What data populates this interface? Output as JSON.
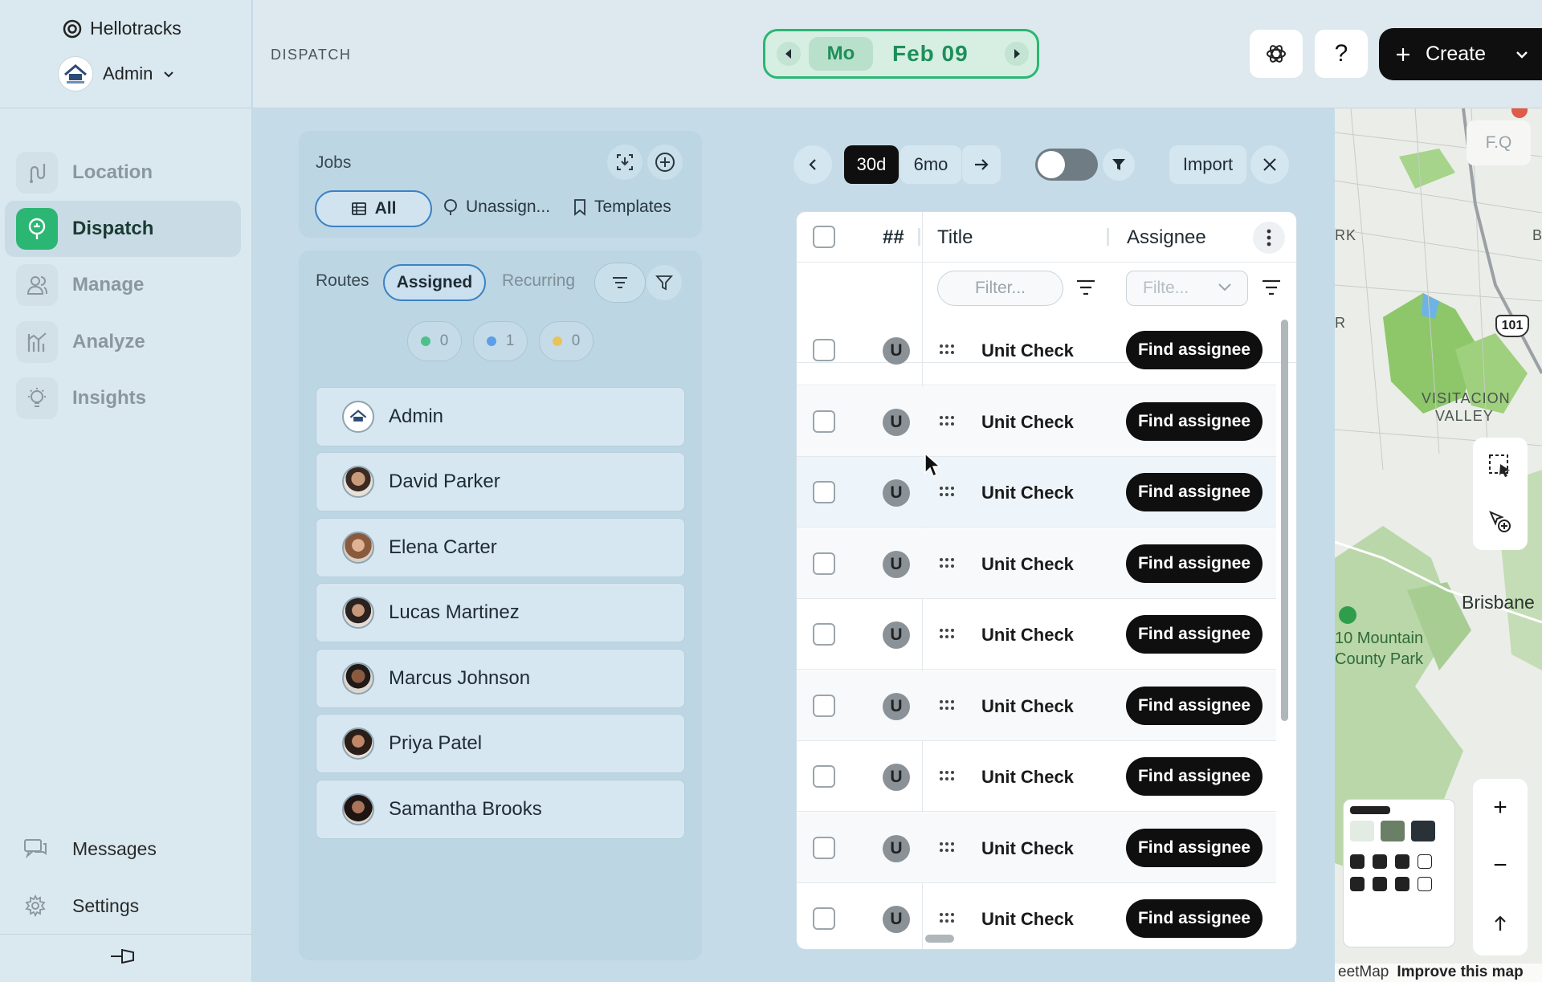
{
  "sidebar": {
    "brand": "Hellotracks",
    "account_name": "Admin",
    "nav": [
      {
        "label": "Location"
      },
      {
        "label": "Dispatch"
      },
      {
        "label": "Manage"
      },
      {
        "label": "Analyze"
      },
      {
        "label": "Insights"
      }
    ],
    "messages_label": "Messages",
    "settings_label": "Settings"
  },
  "topbar": {
    "section": "DISPATCH",
    "day": "Mo",
    "date": "Feb 09",
    "help_label": "?",
    "create_label": "Create"
  },
  "jobs": {
    "title": "Jobs",
    "tabs": [
      "All",
      "Unassign...",
      "Templates"
    ],
    "routes_label": "Routes",
    "assigned_label": "Assigned",
    "recurring_label": "Recurring",
    "counts": [
      "0",
      "1",
      "0"
    ],
    "routes": [
      {
        "name": "Admin"
      },
      {
        "name": "David Parker"
      },
      {
        "name": "Elena Carter"
      },
      {
        "name": "Lucas Martinez"
      },
      {
        "name": "Marcus Johnson"
      },
      {
        "name": "Priya Patel"
      },
      {
        "name": "Samantha Brooks"
      }
    ]
  },
  "toolbar": {
    "range_30d": "30d",
    "range_6mo": "6mo",
    "import_label": "Import"
  },
  "table": {
    "col_num": "##",
    "col_title": "Title",
    "col_assignee": "Assignee",
    "filter_title_placeholder": "Filter...",
    "filter_assignee_placeholder": "Filte...",
    "rows": [
      {
        "badge": "U",
        "title": "Unit Check",
        "action": "Find assignee"
      },
      {
        "badge": "U",
        "title": "Unit Check",
        "action": "Find assignee"
      },
      {
        "badge": "U",
        "title": "Unit Check",
        "action": "Find assignee"
      },
      {
        "badge": "U",
        "title": "Unit Check",
        "action": "Find assignee"
      },
      {
        "badge": "U",
        "title": "Unit Check",
        "action": "Find assignee"
      },
      {
        "badge": "U",
        "title": "Unit Check",
        "action": "Find assignee"
      },
      {
        "badge": "U",
        "title": "Unit Check",
        "action": "Find assignee"
      },
      {
        "badge": "U",
        "title": "Unit Check",
        "action": "Find assignee"
      },
      {
        "badge": "U",
        "title": "Unit Check",
        "action": "Find assignee"
      }
    ]
  },
  "map": {
    "search_placeholder": "F.Q",
    "labels": [
      "RK",
      "B",
      "R",
      "VISITACION",
      "VALLEY",
      "Brisbane",
      "10 Mountain",
      "County Park",
      "101"
    ],
    "footer_left": "eetMap",
    "footer_right": "Improve this map",
    "zoom_in": "+",
    "zoom_out": "−"
  },
  "colors": {
    "accent_green": "#2bb673",
    "accent_blue": "#3b82c4",
    "dark": "#0f0f0f"
  }
}
